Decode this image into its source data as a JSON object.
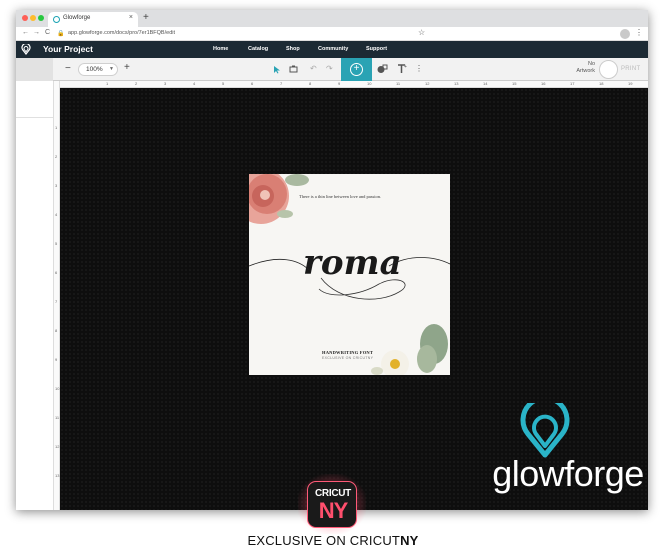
{
  "browser": {
    "tab_title": "Glowforge",
    "tab_close": "×",
    "new_tab": "+",
    "url": "app.glowforge.com/docs/pro/7er1BFQB/edit",
    "back": "←",
    "forward": "→",
    "reload": "C"
  },
  "app": {
    "project_title": "Your Project",
    "nav": [
      "Home",
      "Catalog",
      "Shop",
      "Community",
      "Support"
    ]
  },
  "toolbar": {
    "zoom_minus": "−",
    "zoom_value": "100%",
    "zoom_plus": "+",
    "no_artwork_line1": "No",
    "no_artwork_line2": "Artwork",
    "print_label": "PRINT",
    "accent_color": "#2aa3b4"
  },
  "ruler": {
    "h_ticks": [
      "1",
      "2",
      "3",
      "4",
      "5",
      "6",
      "7",
      "8",
      "9",
      "10",
      "11",
      "12",
      "13",
      "14",
      "15",
      "16",
      "17",
      "18",
      "19",
      "20"
    ],
    "v_ticks": [
      "1",
      "2",
      "3",
      "4",
      "5",
      "6",
      "7",
      "8",
      "9",
      "10",
      "11",
      "12",
      "13"
    ]
  },
  "artwork": {
    "tagline": "There is a thin line between love and passion.",
    "script_title": "roma",
    "subtitle1": "HANDWRITING FONT",
    "subtitle2": "EXCLUSIVE ON CRICUTNY"
  },
  "watermark": {
    "brand": "glowforge",
    "badge_line1": "CRICUT",
    "badge_line2": "NY",
    "footer_prefix": "EXCLUSIVE ON CRICUT",
    "footer_bold": "NY"
  }
}
